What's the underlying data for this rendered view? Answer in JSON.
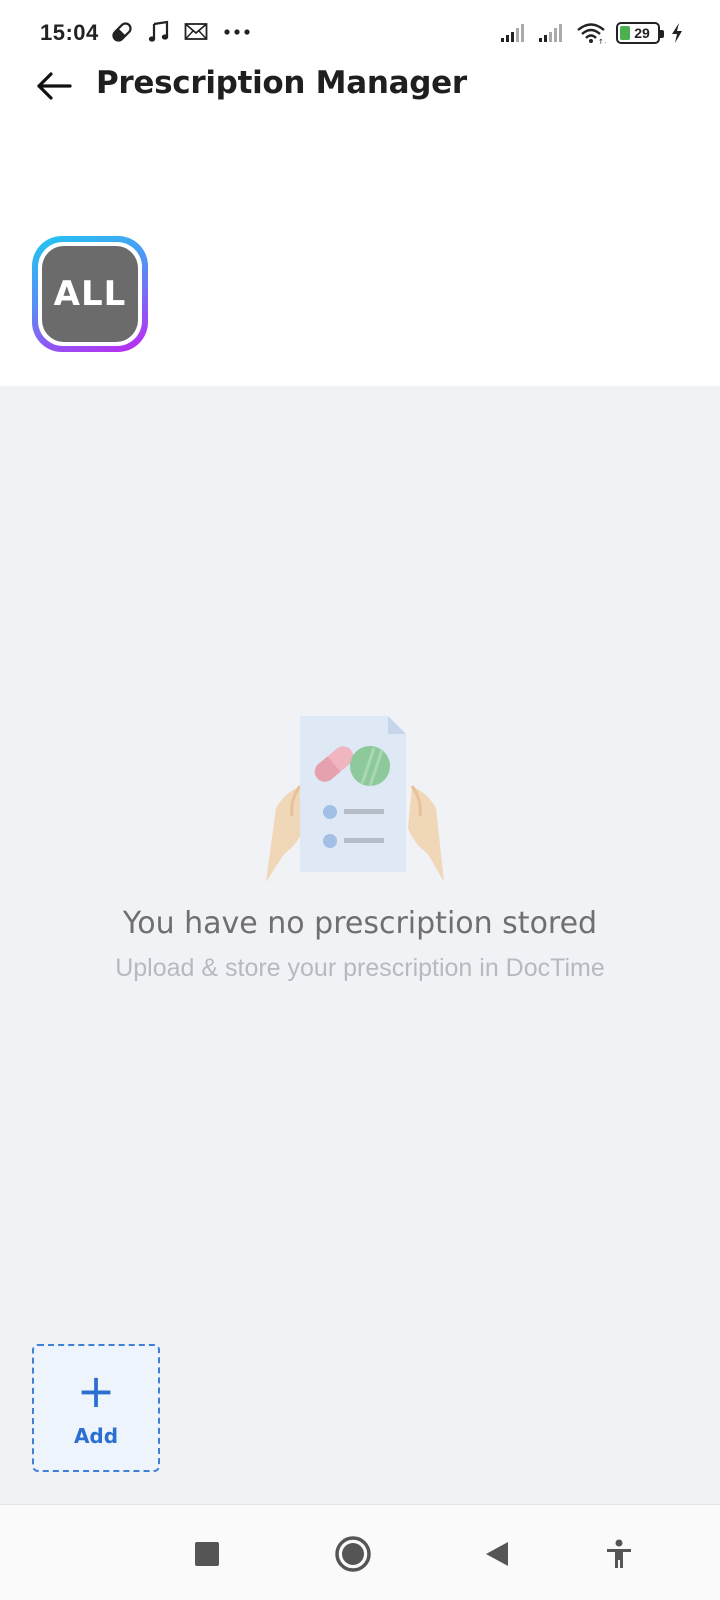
{
  "status_bar": {
    "time": "15:04",
    "battery_level": "29",
    "icons_left": [
      "pill-icon",
      "music-note-icon",
      "mail-icon",
      "more-dots-icon"
    ],
    "icons_right": [
      "signal-icon",
      "signal-icon",
      "wifi-icon",
      "battery-icon",
      "charging-icon"
    ]
  },
  "header": {
    "title": "Prescription Manager"
  },
  "filter": {
    "all_label": "ALL"
  },
  "empty_state": {
    "title": "You have no prescription stored",
    "subtitle": "Upload & store your prescription in DocTime"
  },
  "add": {
    "plus": "+",
    "label": "Add"
  },
  "colors": {
    "accent": "#2b6fd0",
    "chip_gradient_start": "#1ec8f0",
    "chip_gradient_end": "#c026f0",
    "chip_fill": "#6b6b6b",
    "content_bg": "#f0f2f6"
  }
}
